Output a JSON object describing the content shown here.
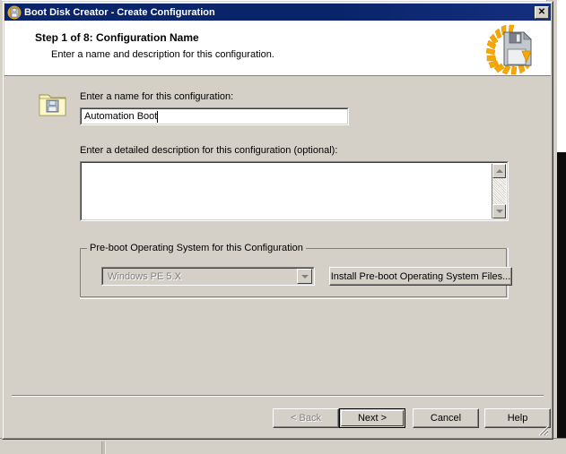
{
  "window": {
    "title": "Boot Disk Creator - Create Configuration",
    "title_icon": "app-disk-icon",
    "close_label": "✕"
  },
  "header": {
    "step_title": "Step 1 of 8: Configuration Name",
    "step_subtitle": "Enter a name and description for this configuration.",
    "logo_icon": "floppy-disk-sunburst-icon"
  },
  "form": {
    "folder_icon": "folder-with-floppy-icon",
    "name_label": "Enter a name for this configuration:",
    "name_value": "Automation Boot",
    "name_placeholder": "",
    "description_label": "Enter a detailed description for this configuration (optional):",
    "description_value": "",
    "description_placeholder": ""
  },
  "groupbox": {
    "title": "Pre-boot Operating System for this Configuration",
    "os_selected": "Windows PE 5.X",
    "os_options": [
      "Windows PE 5.X"
    ],
    "install_button": "Install Pre-boot Operating System Files..."
  },
  "footer": {
    "back": "< Back",
    "next": "Next >",
    "cancel": "Cancel",
    "help": "Help"
  },
  "colors": {
    "title_bar": "#0A246A",
    "dialog_face": "#D4D0C8",
    "header_band": "#FFFFFF",
    "disabled_text": "#808080",
    "logo_accent": "#F5A800",
    "folder_yellow": "#F5F0A8"
  }
}
